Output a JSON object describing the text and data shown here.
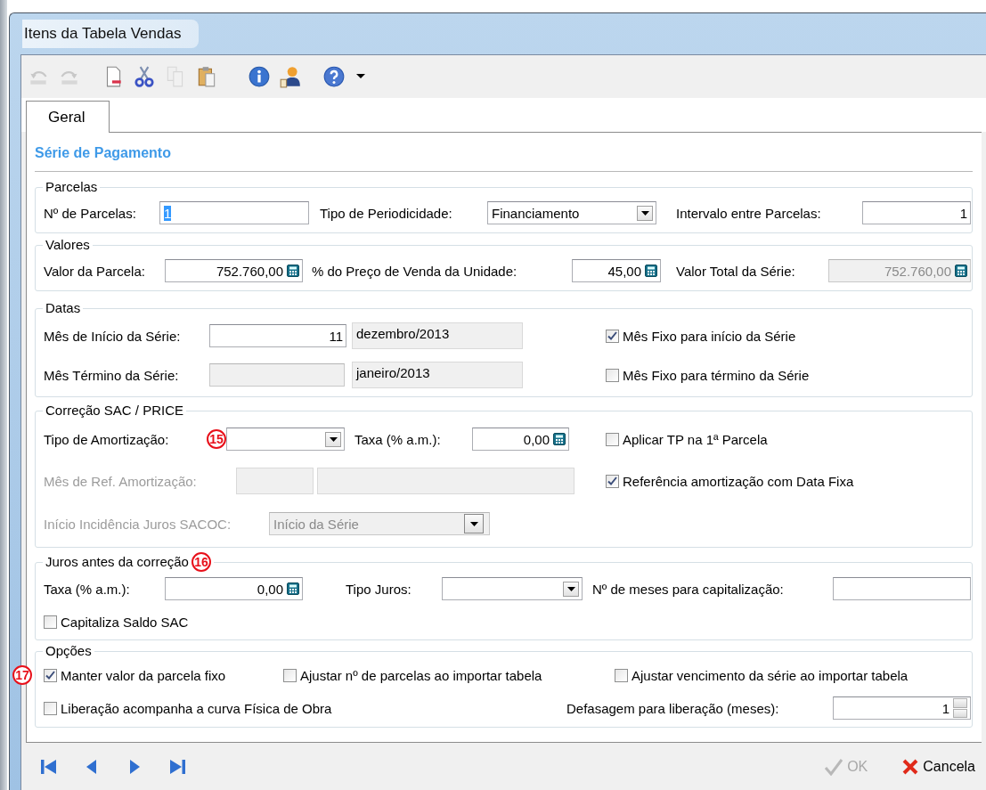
{
  "window": {
    "title": "Itens da Tabela Vendas"
  },
  "toolbar": [
    {
      "kind": "undo",
      "disabled": true
    },
    {
      "kind": "redo",
      "disabled": true
    },
    {
      "kind": "document",
      "disabled": false
    },
    {
      "kind": "cut",
      "disabled": false
    },
    {
      "kind": "copy",
      "disabled": true
    },
    {
      "kind": "paste",
      "disabled": false
    },
    {
      "kind": "info",
      "disabled": false
    },
    {
      "kind": "person",
      "disabled": false
    },
    {
      "kind": "help",
      "disabled": false
    },
    {
      "kind": "caret",
      "disabled": false
    }
  ],
  "tabs": [
    {
      "label": "Geral",
      "selected": true
    }
  ],
  "section_title": "Série de Pagamento",
  "groups": [
    {
      "title": "Parcelas",
      "rows": [
        {
          "items": [
            {
              "kind": "label",
              "text": "Nº de Parcelas:",
              "disabled": false
            },
            {
              "kind": "field",
              "value": "1",
              "disabled": false,
              "text_selected": true
            },
            {
              "kind": "label",
              "text": "Tipo de Periodicidade:",
              "disabled": false
            },
            {
              "kind": "combo",
              "value": "Financiamento",
              "disabled": false
            },
            {
              "kind": "label",
              "text": "Intervalo entre Parcelas:",
              "disabled": false
            },
            {
              "kind": "field",
              "value": "1",
              "disabled": false,
              "text_selected": false
            }
          ]
        }
      ]
    },
    {
      "title": "Valores",
      "rows": [
        {
          "items": [
            {
              "kind": "label",
              "text": "Valor da Parcela:",
              "disabled": false
            },
            {
              "kind": "calc",
              "value": "752.760,00",
              "disabled": false
            },
            {
              "kind": "label",
              "text": "% do Preço de Venda da Unidade:",
              "disabled": false
            },
            {
              "kind": "calc",
              "value": "45,00",
              "disabled": false
            },
            {
              "kind": "label",
              "text": "Valor Total da Série:",
              "disabled": false
            },
            {
              "kind": "calc",
              "value": "752.760,00",
              "disabled": true
            }
          ]
        }
      ]
    },
    {
      "title": "Datas",
      "rows": [
        {
          "items": [
            {
              "kind": "label",
              "text": "Mês de Início da Série:",
              "disabled": false
            },
            {
              "kind": "field",
              "value": "11",
              "disabled": false,
              "text_selected": false
            },
            {
              "kind": "box",
              "value": "dezembro/2013"
            },
            {
              "kind": "check",
              "text": "Mês Fixo para início da Série",
              "checked": true
            }
          ]
        },
        {
          "items": [
            {
              "kind": "label",
              "text": "Mês Término da Série:",
              "disabled": false
            },
            {
              "kind": "field",
              "disabled": true
            },
            {
              "kind": "box",
              "value": "janeiro/2013"
            },
            {
              "kind": "check",
              "text": "Mês Fixo para término da Série",
              "checked": false
            }
          ]
        }
      ]
    },
    {
      "title": "Correção SAC / PRICE",
      "rows": [
        {
          "items": [
            {
              "kind": "label",
              "text": "Tipo de Amortização:",
              "disabled": false
            },
            {
              "kind": "marker",
              "text": "15"
            },
            {
              "kind": "combo",
              "disabled": false
            },
            {
              "kind": "label",
              "text": "Taxa (% a.m.):",
              "disabled": false
            },
            {
              "kind": "calc",
              "value": "0,00",
              "disabled": false
            },
            {
              "kind": "check",
              "text": "Aplicar TP na 1ª Parcela",
              "checked": false
            }
          ]
        },
        {
          "items": [
            {
              "kind": "label",
              "text": "Mês de Ref. Amortização:",
              "disabled": true
            },
            {
              "kind": "box"
            },
            {
              "kind": "box"
            },
            {
              "kind": "check",
              "text": "Referência amortização com Data Fixa",
              "checked": true
            }
          ]
        },
        {
          "items": [
            {
              "kind": "label",
              "text": "Início Incidência Juros SACOC:",
              "disabled": true
            },
            {
              "kind": "combo",
              "value": "Início da Série",
              "disabled": true
            }
          ]
        }
      ]
    },
    {
      "title": "Juros antes da correção",
      "marker": "16",
      "rows": [
        {
          "items": [
            {
              "kind": "label",
              "text": "Taxa (% a.m.):",
              "disabled": false
            },
            {
              "kind": "calc",
              "value": "0,00",
              "disabled": false
            },
            {
              "kind": "label",
              "text": "Tipo Juros:",
              "disabled": false
            },
            {
              "kind": "combo",
              "disabled": false
            },
            {
              "kind": "label",
              "text": "Nº de meses para capitalização:",
              "disabled": false
            },
            {
              "kind": "field",
              "disabled": false
            }
          ]
        },
        {
          "items": [
            {
              "kind": "check",
              "text": "Capitaliza Saldo SAC",
              "checked": false
            }
          ]
        }
      ]
    },
    {
      "title": "Opções",
      "rows": [
        {
          "items": [
            {
              "kind": "marker",
              "text": "17"
            },
            {
              "kind": "check",
              "text": "Manter valor da parcela fixo",
              "checked": true
            },
            {
              "kind": "check",
              "text": "Ajustar nº de parcelas ao importar tabela",
              "checked": false
            },
            {
              "kind": "check",
              "text": "Ajustar vencimento da série ao importar tabela",
              "checked": false
            }
          ]
        },
        {
          "items": [
            {
              "kind": "check",
              "text": "Liberação acompanha a curva Física de Obra",
              "checked": false
            },
            {
              "kind": "label",
              "text": "Defasagem para liberação (meses):",
              "disabled": false
            },
            {
              "kind": "spin",
              "value": "1",
              "disabled": false
            }
          ]
        }
      ]
    }
  ],
  "buttons": [
    {
      "label": "OK",
      "kind": "ok",
      "disabled": true
    },
    {
      "label": "Cancela",
      "kind": "cancel",
      "disabled": false
    }
  ]
}
